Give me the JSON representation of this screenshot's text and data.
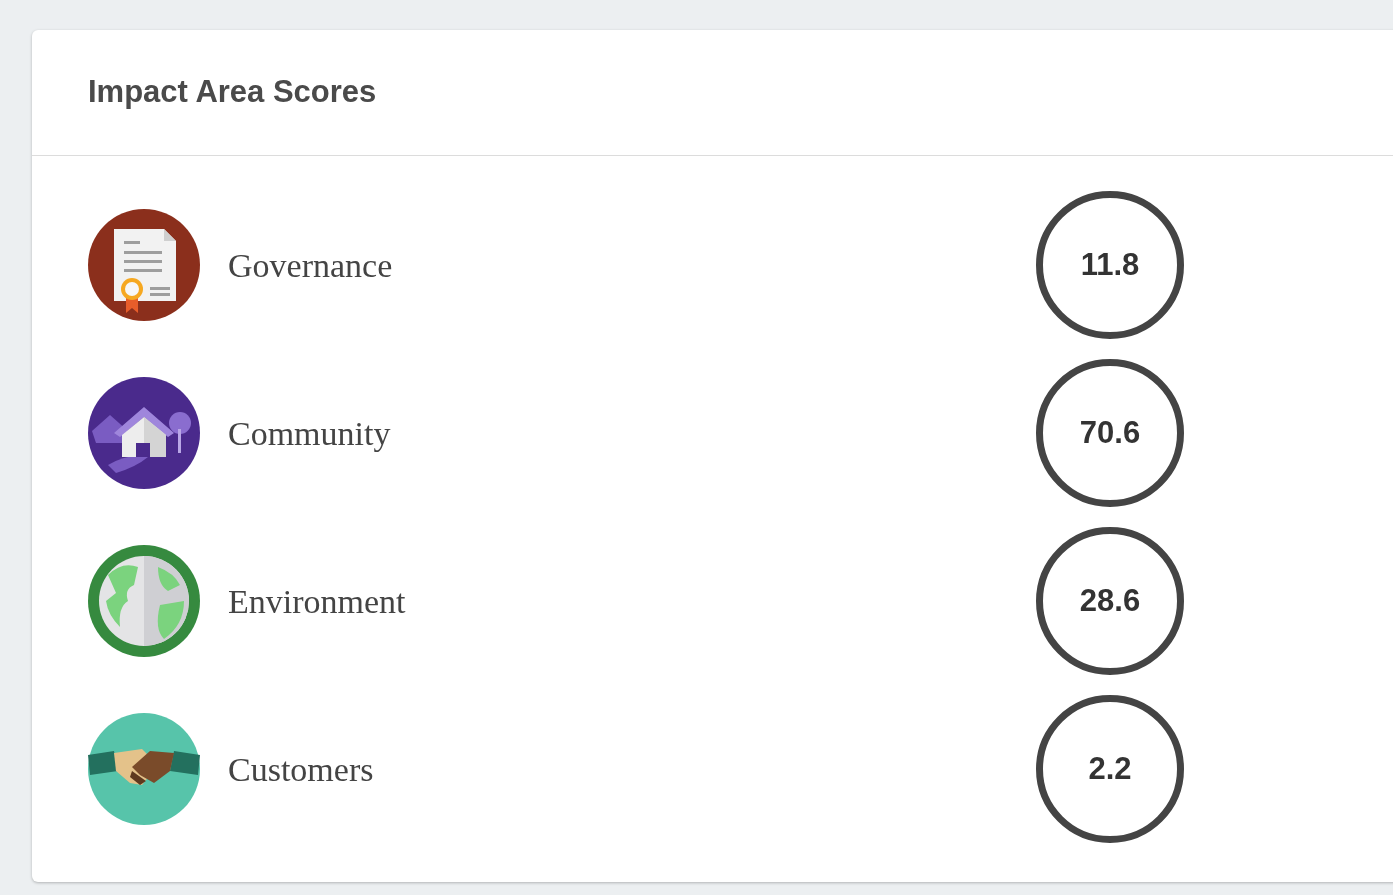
{
  "card": {
    "title": "Impact Area Scores"
  },
  "areas": [
    {
      "kind": "certificate",
      "name": "Governance",
      "score": "11.8"
    },
    {
      "kind": "house",
      "name": "Community",
      "score": "70.6"
    },
    {
      "kind": "globe",
      "name": "Environment",
      "score": "28.6"
    },
    {
      "kind": "handshake",
      "name": "Customers",
      "score": "2.2"
    }
  ]
}
